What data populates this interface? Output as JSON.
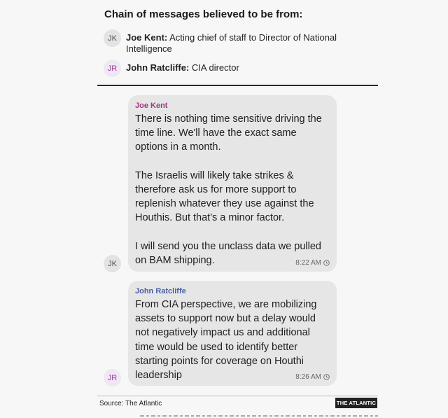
{
  "heading": "Chain of messages believed to be from:",
  "participants": [
    {
      "initials": "JK",
      "name": "Joe Kent:",
      "role": "Acting chief of staff to Director of National Intelligence"
    },
    {
      "initials": "JR",
      "name": "John Ratcliffe:",
      "role": "CIA director"
    }
  ],
  "messages": [
    {
      "sender": "Joe Kent",
      "initials": "JK",
      "text": "There is nothing time sensitive driving the time line. We'll have the exact same options in a month.\n\nThe Israelis will likely take strikes & therefore ask us for more support to replenish whatever they use against the Houthis. But that's a minor factor.\n\nI will send you the unclass data we pulled on BAM shipping.",
      "time": "8:22 AM"
    },
    {
      "sender": "John Ratcliffe",
      "initials": "JR",
      "text": "From CIA perspective, we are mobilizing assets to support now but a delay would not negatively impact us and additional time would be used to identify better starting points for coverage on Houthi leadership",
      "time": "8:26 AM"
    }
  ],
  "footer": {
    "source": "Source: The Atlantic",
    "logo": "THE ATLANTIC"
  },
  "icons": [
    "clock-icon"
  ]
}
